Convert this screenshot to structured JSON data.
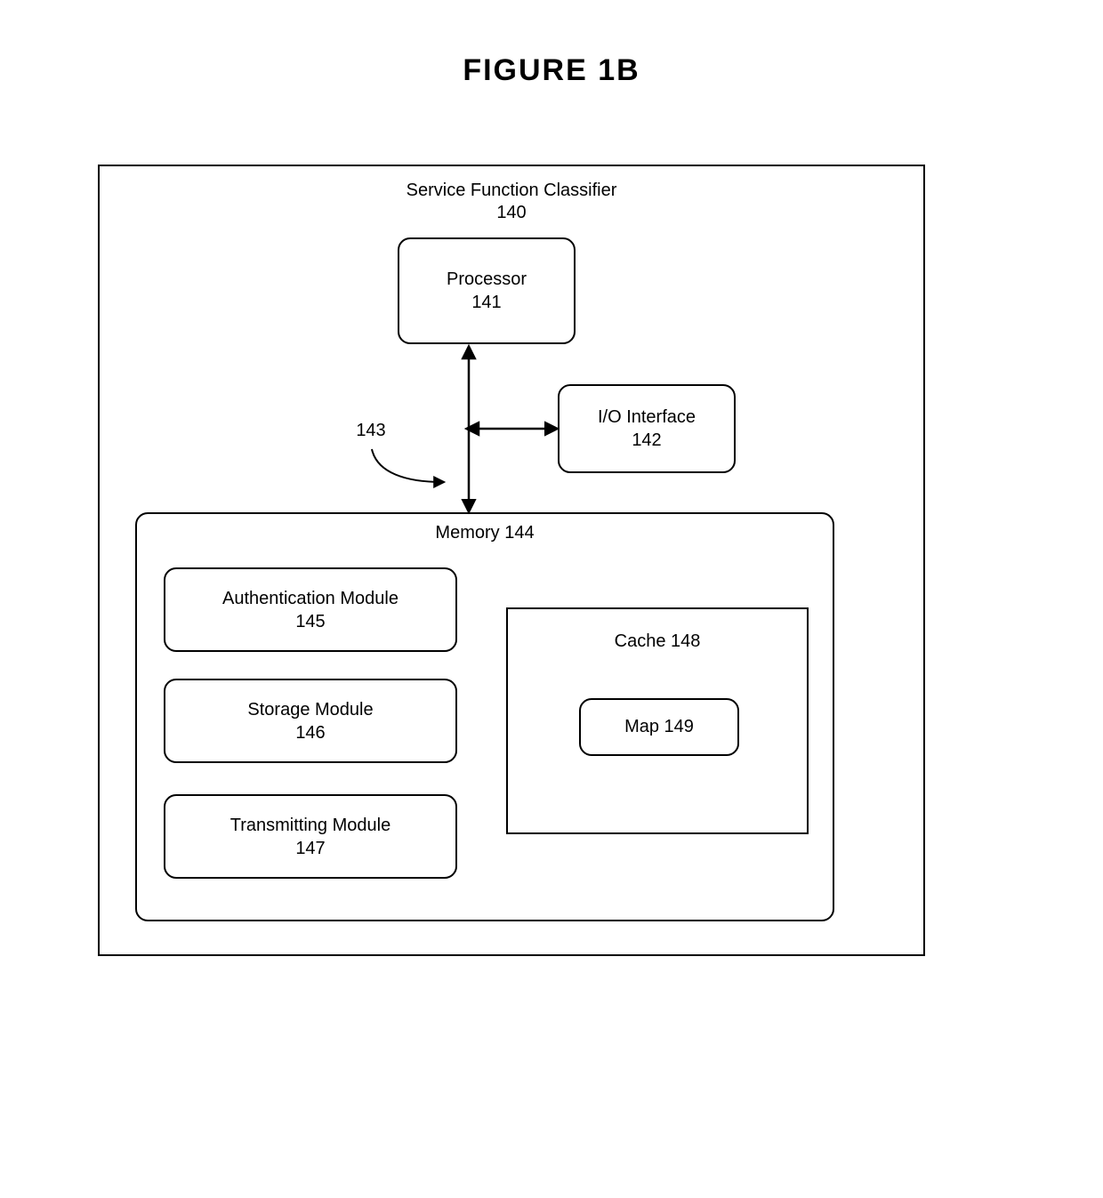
{
  "figure_title": "FIGURE 1B",
  "outer": {
    "title": "Service Function Classifier",
    "ref": "140"
  },
  "processor": {
    "label": "Processor",
    "ref": "141"
  },
  "io": {
    "label": "I/O Interface",
    "ref": "142"
  },
  "bus_ref": "143",
  "memory": {
    "label": "Memory 144"
  },
  "modules": {
    "auth": {
      "label": "Authentication Module",
      "ref": "145"
    },
    "storage": {
      "label": "Storage Module",
      "ref": "146"
    },
    "transmit": {
      "label": "Transmitting Module",
      "ref": "147"
    }
  },
  "cache": {
    "label": "Cache 148"
  },
  "map": {
    "label": "Map 149"
  }
}
